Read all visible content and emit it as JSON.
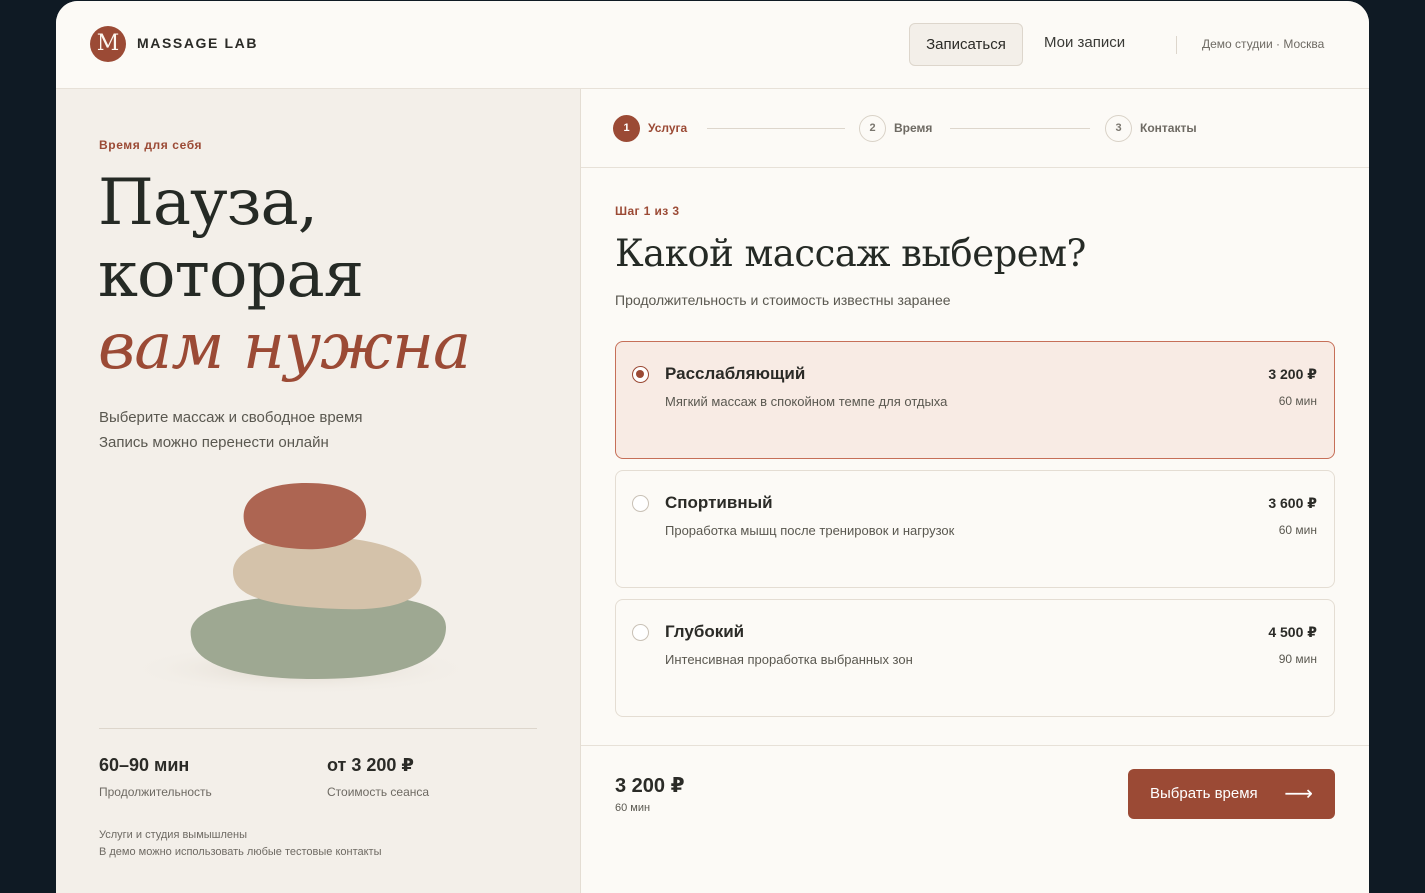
{
  "header": {
    "logo_letter": "M",
    "brand": "MASSAGE LAB",
    "nav_book": "Записаться",
    "nav_mine": "Мои записи",
    "studio": "Демо студии · Москва"
  },
  "left": {
    "eyebrow": "Время для себя",
    "hero_line1": "Пауза,",
    "hero_line2": "которая",
    "hero_line3": "вам нужна",
    "sub_line1": "Выберите массаж и свободное время",
    "sub_line2": "Запись можно перенести онлайн",
    "stats": [
      {
        "value": "60–90 мин",
        "label": "Продолжительность"
      },
      {
        "value": "от 3 200 ₽",
        "label": "Стоимость сеанса"
      }
    ],
    "note_line1": "Услуги и студия вымышлены",
    "note_line2": "В демо можно использовать любые тестовые контакты"
  },
  "steps": [
    {
      "num": "1",
      "label": "Услуга",
      "active": true
    },
    {
      "num": "2",
      "label": "Время",
      "active": false
    },
    {
      "num": "3",
      "label": "Контакты",
      "active": false
    }
  ],
  "main": {
    "step_count": "Шаг 1 из 3",
    "title": "Какой массаж выберем?",
    "subtitle": "Продолжительность и стоимость известны заранее",
    "options": [
      {
        "name": "Расслабляющий",
        "desc": "Мягкий массаж в спокойном темпе для отдыха",
        "price": "3 200 ₽",
        "duration": "60 мин",
        "selected": true
      },
      {
        "name": "Спортивный",
        "desc": "Проработка мышц после тренировок и нагрузок",
        "price": "3 600 ₽",
        "duration": "60 мин",
        "selected": false
      },
      {
        "name": "Глубокий",
        "desc": "Интенсивная проработка выбранных зон",
        "price": "4 500 ₽",
        "duration": "90 мин",
        "selected": false
      }
    ]
  },
  "footer": {
    "price": "3 200 ₽",
    "duration": "60 мин",
    "cta": "Выбрать время",
    "cta_icon": "arrow-right-icon"
  },
  "colors": {
    "accent": "#9b4a35",
    "background": "#fcfaf6",
    "panel": "#f3efe9",
    "selected_card": "#f8ebe4",
    "page_backdrop": "#0f1a24"
  }
}
